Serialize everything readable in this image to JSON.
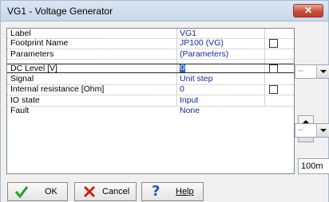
{
  "window": {
    "title": "VG1 - Voltage Generator",
    "close_glyph": "✕"
  },
  "properties": [
    {
      "label": "Label",
      "value": "VG1",
      "has_check": false
    },
    {
      "label": "Footprint Name",
      "value": "JP100 (VG)",
      "has_check": true
    },
    {
      "label": "Parameters",
      "value": "(Parameters)",
      "has_check": false
    },
    {
      "label": "DC Level [V]",
      "value": "0",
      "has_check": true
    },
    {
      "label": "Signal",
      "value": "Unit step",
      "has_check": false
    },
    {
      "label": "Internal resistance [Ohm]",
      "value": "0",
      "has_check": true
    },
    {
      "label": "IO state",
      "value": "Input",
      "has_check": false
    },
    {
      "label": "Fault",
      "value": "None",
      "has_check": false
    }
  ],
  "side": {
    "combo1_value": "--",
    "combo2_value": "--",
    "scale_value": "100m"
  },
  "buttons": {
    "ok_label": "OK",
    "cancel_label": "Cancel",
    "help_label": "Help",
    "help_glyph": "?"
  },
  "colors": {
    "value_text": "#1a2b8c",
    "close_red": "#c9503a",
    "selection_blue": "#3060c8"
  }
}
